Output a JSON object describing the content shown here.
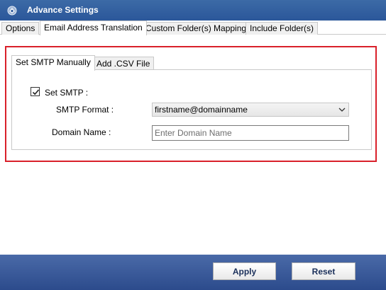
{
  "window": {
    "title": "Advance Settings",
    "icon": "app-icon"
  },
  "tabs": [
    {
      "label": "Options",
      "active": false
    },
    {
      "label": "Email Address Translation",
      "active": true
    },
    {
      "label": "Custom Folder(s) Mapping",
      "active": false
    },
    {
      "label": "Include Folder(s)",
      "active": false
    }
  ],
  "smtp_panel": {
    "tabs": [
      {
        "label": "Set SMTP Manually",
        "active": true
      },
      {
        "label": "Add .CSV File",
        "active": false
      }
    ],
    "set_smtp": {
      "label": "Set SMTP :",
      "checked": true
    },
    "smtp_format": {
      "label": "SMTP Format :",
      "selected": "firstname@domainname"
    },
    "domain_name": {
      "label": "Domain Name :",
      "value": "",
      "placeholder": "Enter Domain Name"
    },
    "highlight_color": "#d9202a"
  },
  "footer": {
    "apply_label": "Apply",
    "reset_label": "Reset"
  },
  "colors": {
    "titlebar": "#2b579a",
    "footer": "#2c4b8c"
  }
}
